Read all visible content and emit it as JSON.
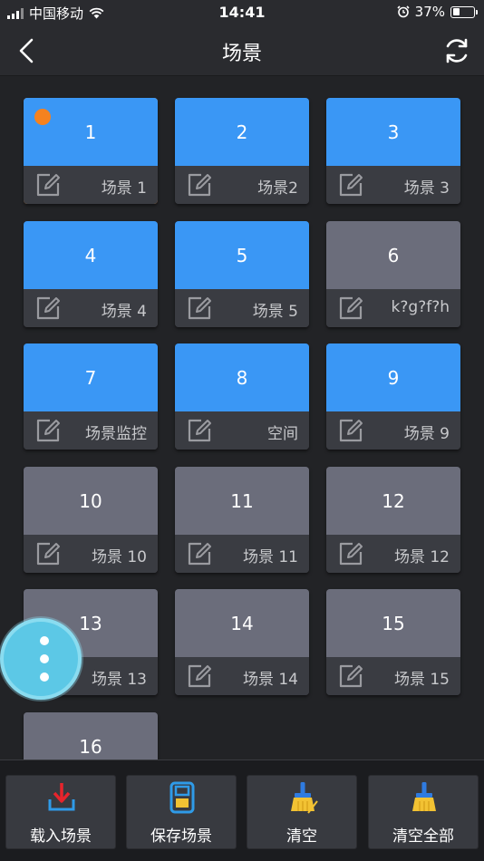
{
  "status_bar": {
    "carrier": "中国移动",
    "time": "14:41",
    "battery": "37%",
    "battery_level": 0.37
  },
  "nav": {
    "title": "场景"
  },
  "tiles": [
    {
      "number": "1",
      "label": "场景 1",
      "active": true,
      "selected": true
    },
    {
      "number": "2",
      "label": "场景2",
      "active": true
    },
    {
      "number": "3",
      "label": "场景 3",
      "active": true
    },
    {
      "number": "4",
      "label": "场景 4",
      "active": true
    },
    {
      "number": "5",
      "label": "场景 5",
      "active": true
    },
    {
      "number": "6",
      "label": "k?g?f?h",
      "active": false
    },
    {
      "number": "7",
      "label": "场景监控",
      "active": true
    },
    {
      "number": "8",
      "label": "空间",
      "active": true
    },
    {
      "number": "9",
      "label": "场景 9",
      "active": true
    },
    {
      "number": "10",
      "label": "场景 10",
      "active": false
    },
    {
      "number": "11",
      "label": "场景 11",
      "active": false
    },
    {
      "number": "12",
      "label": "场景 12",
      "active": false
    },
    {
      "number": "13",
      "label": "场景 13",
      "active": false
    },
    {
      "number": "14",
      "label": "场景 14",
      "active": false
    },
    {
      "number": "15",
      "label": "场景 15",
      "active": false
    },
    {
      "number": "16",
      "label": "",
      "active": false
    }
  ],
  "toolbar": {
    "load_label": "载入场景",
    "save_label": "保存场景",
    "clear_label": "清空",
    "clear_all_label": "清空全部"
  },
  "colors": {
    "active_tile": "#3a97f5",
    "inactive_tile": "#6b6d7b",
    "selected_outline": "#f5821f",
    "fab": "#5cc8e6",
    "load_icon": "#e8242c",
    "save_icon": "#2f9be8",
    "broom_handle": "#2f7be0",
    "broom_bristles": "#f2c233"
  }
}
